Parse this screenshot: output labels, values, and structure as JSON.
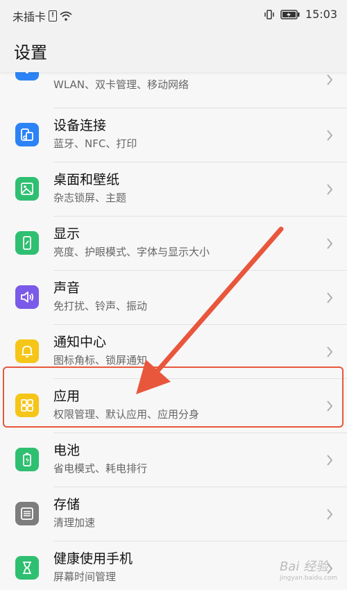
{
  "status_bar": {
    "carrier": "未插卡",
    "time": "15:03",
    "icons": [
      "sim-icon",
      "wifi-icon",
      "vibrate-icon",
      "battery-icon"
    ]
  },
  "header": {
    "title": "设置"
  },
  "items": [
    {
      "id": "wlan",
      "title": "",
      "subtitle": "WLAN、双卡管理、移动网络",
      "icon": "wifi-icon",
      "color": "#2c83f6"
    },
    {
      "id": "device",
      "title": "设备连接",
      "subtitle": "蓝牙、NFC、打印",
      "icon": "device-connection-icon",
      "color": "#2c83f6"
    },
    {
      "id": "desktop",
      "title": "桌面和壁纸",
      "subtitle": "杂志锁屏、主题",
      "icon": "wallpaper-icon",
      "color": "#2fbf71"
    },
    {
      "id": "display",
      "title": "显示",
      "subtitle": "亮度、护眼模式、字体与显示大小",
      "icon": "display-icon",
      "color": "#2fbf71"
    },
    {
      "id": "sound",
      "title": "声音",
      "subtitle": "免打扰、铃声、振动",
      "icon": "sound-icon",
      "color": "#7a5ae8"
    },
    {
      "id": "notification",
      "title": "通知中心",
      "subtitle": "图标角标、锁屏通知",
      "icon": "bell-icon",
      "color": "#f5c518"
    },
    {
      "id": "apps",
      "title": "应用",
      "subtitle": "权限管理、默认应用、应用分身",
      "icon": "apps-grid-icon",
      "color": "#f5c518"
    },
    {
      "id": "battery",
      "title": "电池",
      "subtitle": "省电模式、耗电排行",
      "icon": "battery-icon",
      "color": "#2fbf71"
    },
    {
      "id": "storage",
      "title": "存储",
      "subtitle": "清理加速",
      "icon": "storage-icon",
      "color": "#7d7d7d"
    },
    {
      "id": "health",
      "title": "健康使用手机",
      "subtitle": "屏幕时间管理",
      "icon": "hourglass-icon",
      "color": "#2fbf71"
    }
  ],
  "annotation": {
    "color": "#e8573c"
  },
  "watermark": {
    "text": "Bai 经验",
    "url": "jingyan.baidu.com"
  }
}
